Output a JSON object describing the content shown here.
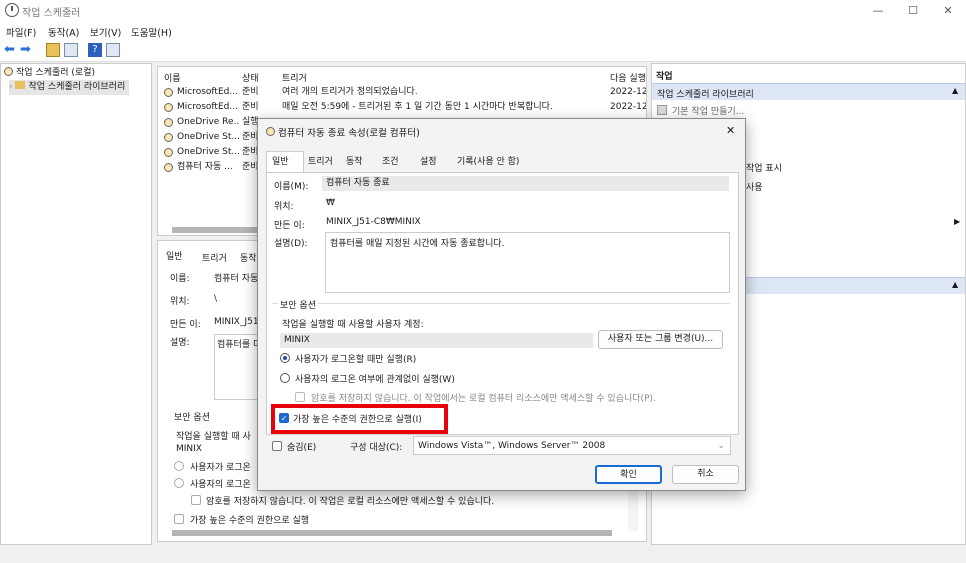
{
  "window": {
    "title": "작업 스케줄러",
    "minimize": "—",
    "maximize": "☐",
    "close": "✕"
  },
  "menu": [
    "파일(F)",
    "동작(A)",
    "보기(V)",
    "도움말(H)"
  ],
  "tree": {
    "root": "작업 스케줄러 (로컬)",
    "child": "작업 스케줄러 라이브러리"
  },
  "task_list": {
    "headers": [
      "이름",
      "상태",
      "트리거",
      "다음 실행"
    ],
    "rows": [
      {
        "name": "MicrosoftEd...",
        "status": "준비",
        "trigger": "여러 개의 트리거가 정의되었습니다.",
        "next": "2022-12-"
      },
      {
        "name": "MicrosoftEd...",
        "status": "준비",
        "trigger": "매일 오전 5:59에 - 트리거된 후 1 일 기간 동안 1 시간마다 반복합니다.",
        "next": "2022-12-"
      },
      {
        "name": "OneDrive Re...",
        "status": "실행",
        "trigger": "",
        "next": ""
      },
      {
        "name": "OneDrive St...",
        "status": "준비",
        "trigger": "",
        "next": ""
      },
      {
        "name": "OneDrive St...",
        "status": "준비",
        "trigger": "",
        "next": ""
      },
      {
        "name": "컴퓨터 자동 ...",
        "status": "준비",
        "trigger": "",
        "next": ""
      }
    ]
  },
  "detail_pane": {
    "tabs": [
      "일반",
      "트리거",
      "동작"
    ],
    "name_label": "이름:",
    "name_value": "컴퓨터 자동",
    "location_label": "위치:",
    "location_value": "\\",
    "author_label": "만든 이:",
    "author_value": "MINIX_J51-",
    "desc_label": "설명:",
    "desc_value": "컴퓨터를 미",
    "security_title": "보안 옵션",
    "run_as_label": "작업을 실행할 때 사",
    "account": "MINIX",
    "radio1": "사용자가 로그온",
    "radio2": "사용자의 로그온",
    "nopass": "암호를 저장하지 않습니다. 이 작업은 로컬 리소스에만 액세스할 수 있습니다.",
    "highest": "가장 높은 수준의 권한으로 실행"
  },
  "actions_pane": {
    "header": "작업",
    "section1": "작업 스케줄러 라이브러리",
    "item_create_basic": "기본 작업 만들기...",
    "item_show": "작업 표시",
    "item_use": "사용"
  },
  "dialog": {
    "title": "컴퓨터 자동 종료 속성(로컬 컴퓨터)",
    "close": "✕",
    "tabs": [
      "일반",
      "트리거",
      "동작",
      "조건",
      "설정",
      "기록(사용 안 함)"
    ],
    "name_label": "이름(M):",
    "name_value": "컴퓨터 자동 종료",
    "location_label": "위치:",
    "location_value": "₩",
    "author_label": "만든 이:",
    "author_value": "MINIX_J51-C8₩MINIX",
    "desc_label": "설명(D):",
    "desc_value": "컴퓨터를 매일 지정된 시간에 자동 종료합니다.",
    "security_title": "보안 옵션",
    "run_as_label": "작업을 실행할 때 사용할 사용자 계정:",
    "account": "MINIX",
    "change_user_button": "사용자 또는 그룹 변경(U)...",
    "radio_logged_on": "사용자가 로그온할 때만 실행(R)",
    "radio_whether": "사용자의 로그온 여부에 관계없이 실행(W)",
    "nopass": "암호를 저장하지 않습니다. 이 작업에서는 로컬 컴퓨터 리소스에만 액세스할 수 있습니다(P).",
    "highest": "가장 높은 수준의 권한으로 실행(I)",
    "hidden": "숨김(E)",
    "configure_label": "구성 대상(C):",
    "configure_value": "Windows Vista™, Windows Server™ 2008",
    "ok": "확인",
    "cancel": "취소"
  },
  "colors": {
    "highlight_box": "#e8000b",
    "accent": "#1a6bd1"
  }
}
